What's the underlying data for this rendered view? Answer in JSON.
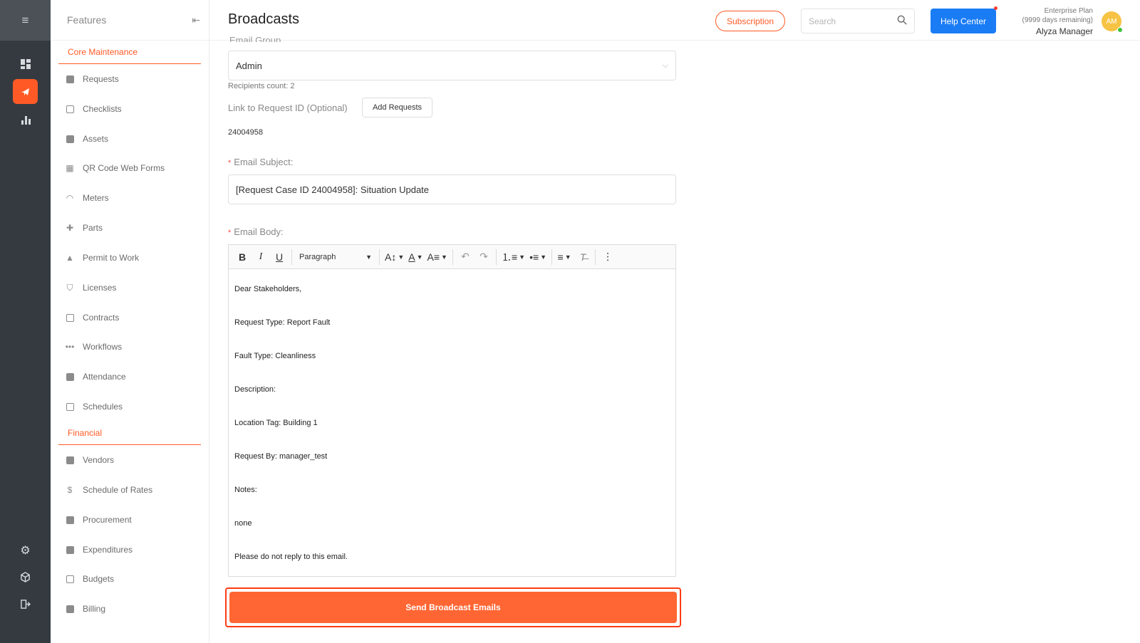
{
  "app": {
    "page_title": "Broadcasts"
  },
  "rail": {
    "icons": [
      "menu-icon",
      "dashboard-icon",
      "broadcast-icon",
      "analytics-icon",
      "settings-icon",
      "cube-icon",
      "logout-icon"
    ],
    "active": "broadcast-icon",
    "accent": "#ff5a25"
  },
  "sidebar": {
    "title": "Features",
    "sections": [
      {
        "label": "Core Maintenance",
        "items": [
          "Requests",
          "Checklists",
          "Assets",
          "QR Code Web Forms",
          "Meters",
          "Parts",
          "Permit to Work",
          "Licenses",
          "Contracts",
          "Workflows",
          "Attendance",
          "Schedules"
        ]
      },
      {
        "label": "Financial",
        "items": [
          "Vendors",
          "Schedule of Rates",
          "Procurement",
          "Expenditures",
          "Budgets",
          "Billing"
        ]
      }
    ]
  },
  "header": {
    "subscription_label": "Subscription",
    "search_placeholder": "Search",
    "help_label": "Help Center",
    "plan_name": "Enterprise Plan",
    "plan_remaining": "(9999 days remaining)",
    "user_name": "Alyza Manager",
    "avatar_initials": "AM",
    "help_color": "#1a7cf5"
  },
  "form": {
    "email_group_label": "Email Group",
    "email_group_value": "Admin",
    "recipients": "Recipients count: 2",
    "link_label": "Link to Request ID (Optional)",
    "add_requests_label": "Add Requests",
    "request_id": "24004958",
    "subject_label": "Email Subject:",
    "subject_value": "[Request Case ID 24004958]: Situation Update",
    "body_label": "Email Body:",
    "toolbar": {
      "bold": "B",
      "italic": "I",
      "underline": "U",
      "paragraph": "Paragraph"
    },
    "body_lines": [
      "Dear Stakeholders,",
      "Request Type: Report Fault",
      "Fault Type: Cleanliness",
      "Description:",
      "Location Tag: Building 1",
      "Request By: manager_test",
      "Notes:",
      "none",
      "Please do not reply to this email."
    ],
    "send_label": "Send Broadcast Emails",
    "send_color": "#ff6633"
  }
}
